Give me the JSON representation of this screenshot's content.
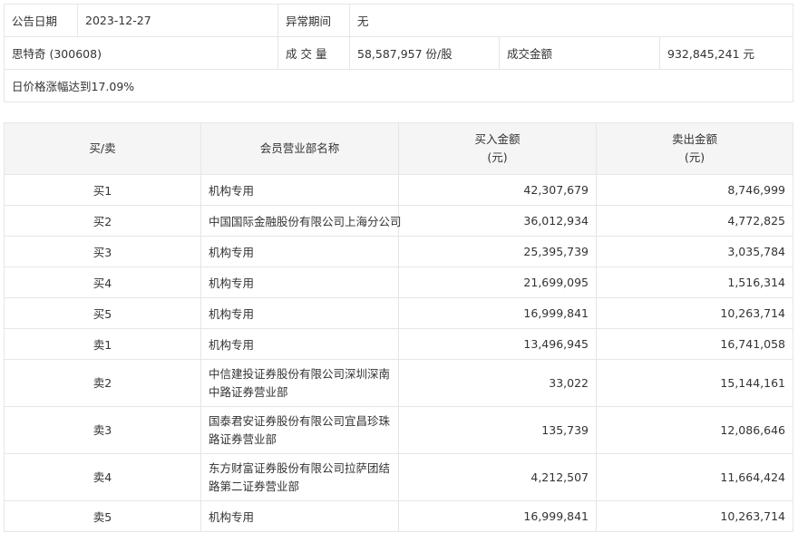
{
  "info": {
    "date_label": "公告日期",
    "date": "2023-12-27",
    "period_label": "异常期间",
    "period": "无",
    "stock": "思特奇 (300608)",
    "volume_label": "成 交 量",
    "volume": "58,587,957 份/股",
    "amount_label": "成交金额",
    "amount": "932,845,241 元",
    "reason": "日价格涨幅达到17.09%"
  },
  "table": {
    "headers": [
      "买/卖",
      "会员营业部名称",
      "买入金额",
      "(元)",
      "卖出金额",
      "(元)"
    ],
    "rows": [
      {
        "side": "买1",
        "name": "机构专用",
        "buy": "42,307,679",
        "sell": "8,746,999"
      },
      {
        "side": "买2",
        "name": "中国国际金融股份有限公司上海分公司",
        "buy": "36,012,934",
        "sell": "4,772,825"
      },
      {
        "side": "买3",
        "name": "机构专用",
        "buy": "25,395,739",
        "sell": "3,035,784"
      },
      {
        "side": "买4",
        "name": "机构专用",
        "buy": "21,699,095",
        "sell": "1,516,314"
      },
      {
        "side": "买5",
        "name": "机构专用",
        "buy": "16,999,841",
        "sell": "10,263,714"
      },
      {
        "side": "卖1",
        "name": "机构专用",
        "buy": "13,496,945",
        "sell": "16,741,058"
      },
      {
        "side": "卖2",
        "name": "中信建投证券股份有限公司深圳深南中路证券营业部",
        "buy": "33,022",
        "sell": "15,144,161"
      },
      {
        "side": "卖3",
        "name": "国泰君安证券股份有限公司宜昌珍珠路证券营业部",
        "buy": "135,739",
        "sell": "12,086,646"
      },
      {
        "side": "卖4",
        "name": "东方财富证券股份有限公司拉萨团结路第二证券营业部",
        "buy": "4,212,507",
        "sell": "11,664,424"
      },
      {
        "side": "卖5",
        "name": "机构专用",
        "buy": "16,999,841",
        "sell": "10,263,714"
      }
    ]
  }
}
